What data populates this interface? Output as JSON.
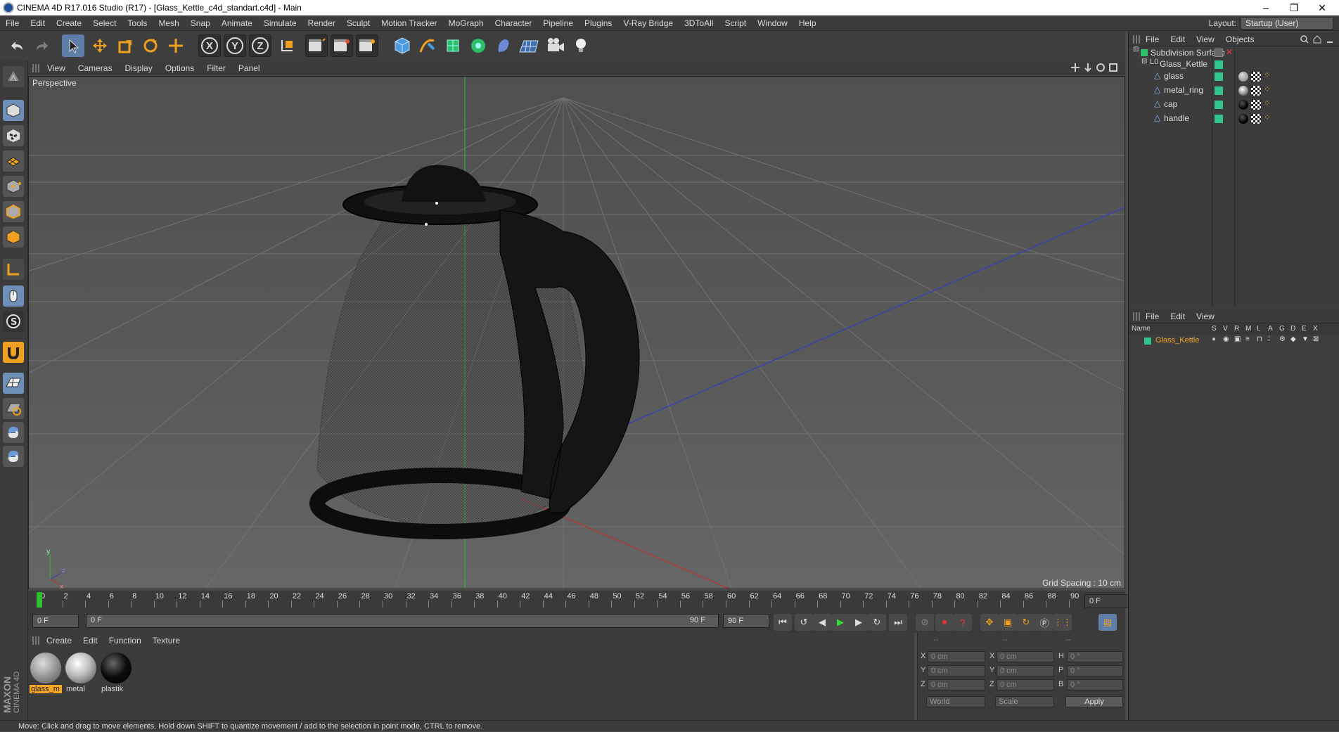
{
  "window": {
    "title": "CINEMA 4D R17.016 Studio (R17) - [Glass_Kettle_c4d_standart.c4d] - Main",
    "controls": [
      "–",
      "❐",
      "✕"
    ]
  },
  "menubar": {
    "items": [
      "File",
      "Edit",
      "Create",
      "Select",
      "Tools",
      "Mesh",
      "Snap",
      "Animate",
      "Simulate",
      "Render",
      "Sculpt",
      "Motion Tracker",
      "MoGraph",
      "Character",
      "Pipeline",
      "Plugins",
      "V-Ray Bridge",
      "3DToAll",
      "Script",
      "Window",
      "Help"
    ],
    "layout_label": "Layout:",
    "layout_value": "Startup (User)"
  },
  "toolbar": {
    "axis_x": "X",
    "axis_y": "Y",
    "axis_z": "Z"
  },
  "viewport": {
    "menu": [
      "View",
      "Cameras",
      "Display",
      "Options",
      "Filter",
      "Panel"
    ],
    "label": "Perspective",
    "grid_spacing": "Grid Spacing : 10 cm",
    "axis_y": "y",
    "axis_z": "z",
    "axis_x": "x"
  },
  "timeline": {
    "ticks": [
      "0",
      "2",
      "4",
      "6",
      "8",
      "10",
      "12",
      "14",
      "16",
      "18",
      "20",
      "22",
      "24",
      "26",
      "28",
      "30",
      "32",
      "34",
      "36",
      "38",
      "40",
      "42",
      "44",
      "46",
      "48",
      "50",
      "52",
      "54",
      "56",
      "58",
      "60",
      "62",
      "64",
      "66",
      "68",
      "70",
      "72",
      "74",
      "76",
      "78",
      "80",
      "82",
      "84",
      "86",
      "88",
      "90"
    ],
    "current_frame": "0 F"
  },
  "transport": {
    "start_frame": "0 F",
    "range_start": "0 F",
    "range_end": "90 F",
    "end_frame": "90 F"
  },
  "materials": {
    "menu": [
      "Create",
      "Edit",
      "Function",
      "Texture"
    ],
    "items": [
      {
        "name": "glass_m",
        "selected": true
      },
      {
        "name": "metal",
        "selected": false
      },
      {
        "name": "plastik",
        "selected": false
      }
    ]
  },
  "coordinates": {
    "header": [
      "--",
      "--",
      "--"
    ],
    "rows": [
      {
        "l1": "X",
        "v1": "0 cm",
        "l2": "X",
        "v2": "0 cm",
        "l3": "H",
        "v3": "0 °"
      },
      {
        "l1": "Y",
        "v1": "0 cm",
        "l2": "Y",
        "v2": "0 cm",
        "l3": "P",
        "v3": "0 °"
      },
      {
        "l1": "Z",
        "v1": "0 cm",
        "l2": "Z",
        "v2": "0 cm",
        "l3": "B",
        "v3": "0 °"
      }
    ],
    "mode_world": "World",
    "mode_scale": "Scale",
    "apply": "Apply"
  },
  "object_manager": {
    "menu": [
      "File",
      "Edit",
      "View",
      "Objects"
    ],
    "items": [
      {
        "name": "Subdivision Surface",
        "level": 0
      },
      {
        "name": "Glass_Kettle",
        "level": 1
      },
      {
        "name": "glass",
        "level": 2
      },
      {
        "name": "metal_ring",
        "level": 2
      },
      {
        "name": "cap",
        "level": 2
      },
      {
        "name": "handle",
        "level": 2
      }
    ]
  },
  "layer_manager": {
    "menu": [
      "File",
      "Edit",
      "View"
    ],
    "columns": [
      "Name",
      "S",
      "V",
      "R",
      "M",
      "L",
      "A",
      "G",
      "D",
      "E",
      "X"
    ],
    "row_name": "Glass_Kettle"
  },
  "colors": {
    "accent_green": "#32c48d",
    "selection_orange": "#f5a623",
    "tool_highlight": "#5f7fa8"
  },
  "branding": {
    "maxon": "MAXON",
    "cinema": "CINEMA 4D"
  },
  "status": {
    "message": "Move: Click and drag to move elements. Hold down SHIFT to quantize movement / add to the selection in point mode, CTRL to remove."
  }
}
